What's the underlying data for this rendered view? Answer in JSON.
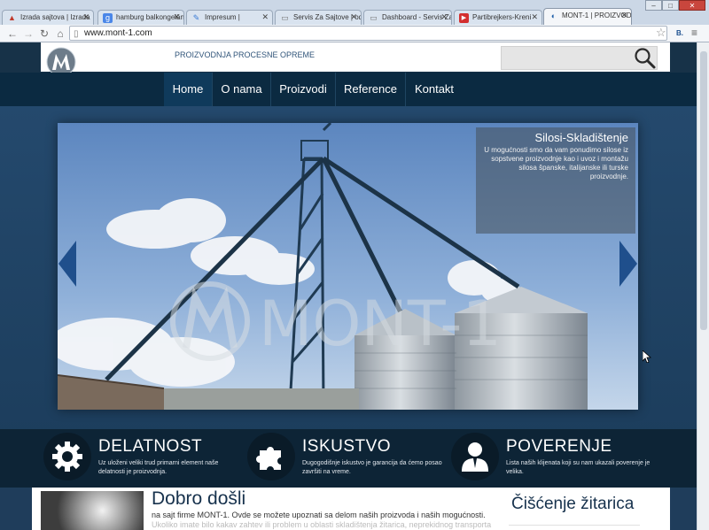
{
  "browser": {
    "tabs": [
      {
        "label": "Izrada sajtova | Izrada",
        "icon": "warning-favicon"
      },
      {
        "label": "hamburg balkongeländ",
        "icon": "google-favicon"
      },
      {
        "label": "Impresum |",
        "icon": "pen-favicon"
      },
      {
        "label": "Servis Za Sajtove | odr",
        "icon": "page-favicon"
      },
      {
        "label": "Dashboard - Servis Za",
        "icon": "page-favicon"
      },
      {
        "label": "Partibrejkers-Kreni",
        "icon": "youtube-favicon"
      },
      {
        "label": "MONT-1 | PROIZVOD",
        "icon": "mont1-favicon"
      }
    ],
    "url": "www.mont-1.com",
    "extension_label": "B."
  },
  "site": {
    "logo_text": "MONT-1",
    "tagline": "PROIZVODNJA PROCESNE OPREME",
    "nav": [
      "Home",
      "O nama",
      "Proizvodi",
      "Reference",
      "Kontakt"
    ],
    "active_nav": "Home",
    "slide": {
      "title": "Silosi-Skladištenje",
      "text": "U mogućnosti smo da vam ponudimo silose iz sopstvene proizvodnje kao i uvoz i montažu silosa španske, italijanske ili turske proizvodnje.",
      "watermark": "MONT-1"
    },
    "features": [
      {
        "title": "DELATNOST",
        "desc": "Uz uloženi veliki trud primarni element naše delatnosti je proizvodnja.",
        "icon": "gear-icon"
      },
      {
        "title": "ISKUSTVO",
        "desc": "Dugogodišnje iskustvo je garancija da ćemo posao završiti na vreme.",
        "icon": "puzzle-icon"
      },
      {
        "title": "POVERENJE",
        "desc": "Lista naših klijenata koji su nam ukazali poverenje je velika.",
        "icon": "person-icon"
      }
    ],
    "welcome": {
      "title": "Dobro došli",
      "text": "na sajt firme MONT-1. Ovde se možete upoznati sa delom naših proizvoda i naših mogućnosti.",
      "text_faded": "Ukoliko imate bilo kakav zahtev ili problem u oblasti skladištenja žitarica, neprekidnog transporta"
    },
    "sidebar_title": "Čišćenje žitarica"
  },
  "colors": {
    "page_bg": "#1f3d5b",
    "nav_bg": "#0b2a41",
    "features_bg": "#0d2436",
    "arrow": "#1f4f8c"
  }
}
